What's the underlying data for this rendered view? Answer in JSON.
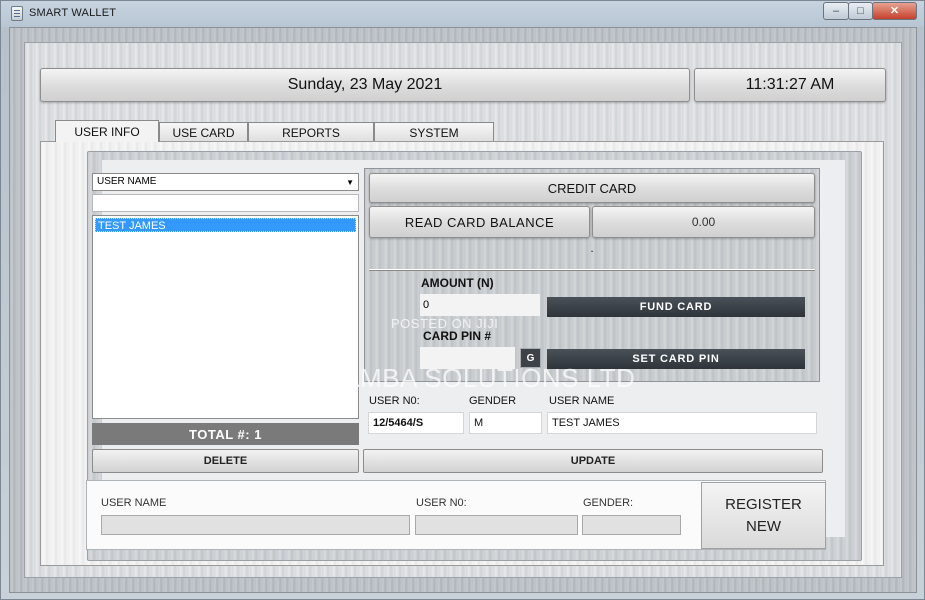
{
  "window": {
    "title": "SMART WALLET",
    "close_glyph": "✕",
    "minimize_glyph": "–",
    "maximize_glyph": "□"
  },
  "header": {
    "date": "Sunday, 23 May 2021",
    "time": "11:31:27 AM"
  },
  "tabs": [
    {
      "label": "USER INFO",
      "active": true
    },
    {
      "label": "USE CARD",
      "active": false
    },
    {
      "label": "REPORTS",
      "active": false
    },
    {
      "label": "SYSTEM",
      "active": false
    }
  ],
  "user_list": {
    "filter_selected": "USER NAME",
    "search_value": "",
    "items": [
      "TEST JAMES"
    ],
    "total_label": "TOTAL #:  1"
  },
  "buttons": {
    "delete": "DELETE",
    "update": "UPDATE"
  },
  "card": {
    "header": "CREDIT CARD",
    "read_balance_label": "READ CARD BALANCE",
    "balance_value": "0.00",
    "status_text": ".",
    "amount_label": "AMOUNT (N)",
    "amount_value": "0",
    "fund_card_label": "FUND CARD",
    "pin_label": "CARD PIN #",
    "pin_value": "",
    "pin_g_label": "G",
    "set_pin_label": "SET CARD PIN"
  },
  "user_details": {
    "userno_label": "USER N0:",
    "gender_label": "GENDER",
    "username_label": "USER NAME",
    "userno_value": "12/5464/S",
    "gender_value": "M",
    "username_value": "TEST JAMES"
  },
  "register": {
    "username_label": "USER NAME",
    "userno_label": "USER N0:",
    "gender_label": "GENDER:",
    "button_label": "REGISTER\nNEW"
  },
  "watermarks": {
    "small": "POSTED ON JIJI",
    "big": "CODEMAMBA SOLUTIONS LTD"
  },
  "colors": {
    "selection": "#3399ff",
    "dark_button": "#3a4046",
    "total_bar": "#7a7a7a"
  }
}
